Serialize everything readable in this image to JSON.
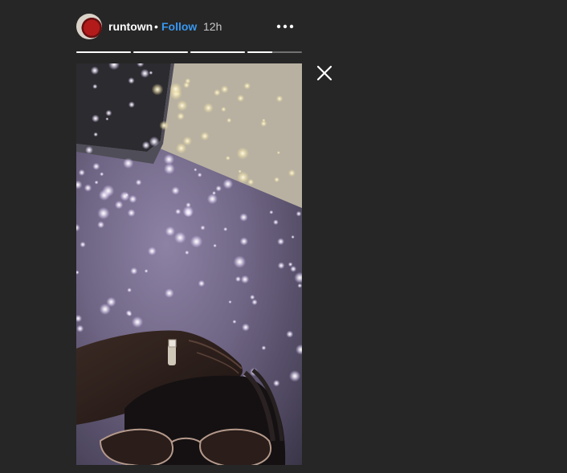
{
  "header": {
    "username": "runtown",
    "separator": "•",
    "follow_label": "Follow",
    "time": "12h",
    "more_icon": "more-horizontal-icon",
    "accent_color": "#3897f0"
  },
  "progress": [
    1,
    1,
    1,
    0.45
  ],
  "close_icon": "close-icon"
}
